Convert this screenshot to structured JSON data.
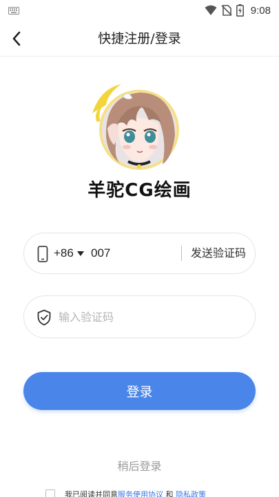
{
  "status_bar": {
    "time": "9:08",
    "icons": [
      "keyboard-icon",
      "wifi-icon",
      "no-sim-icon",
      "battery-charging-icon"
    ]
  },
  "header": {
    "title": "快捷注册/登录",
    "back_icon": "chevron-left-icon"
  },
  "app": {
    "name": "羊驼CG绘画",
    "logo": "anime-avatar-logo"
  },
  "phone": {
    "icon": "mobile-phone-icon",
    "country_code": "+86",
    "number": "007",
    "send_code_label": "发送验证码"
  },
  "code": {
    "icon": "shield-check-icon",
    "placeholder": "输入验证码",
    "value": ""
  },
  "login_button": "登录",
  "later_login": "稍后登录",
  "agreement": {
    "prefix": "我已阅读并同意",
    "terms": "服务使用协议",
    "and": "和",
    "privacy": "隐私政策"
  },
  "colors": {
    "accent": "#4a86ea",
    "link": "#3a78e6"
  }
}
